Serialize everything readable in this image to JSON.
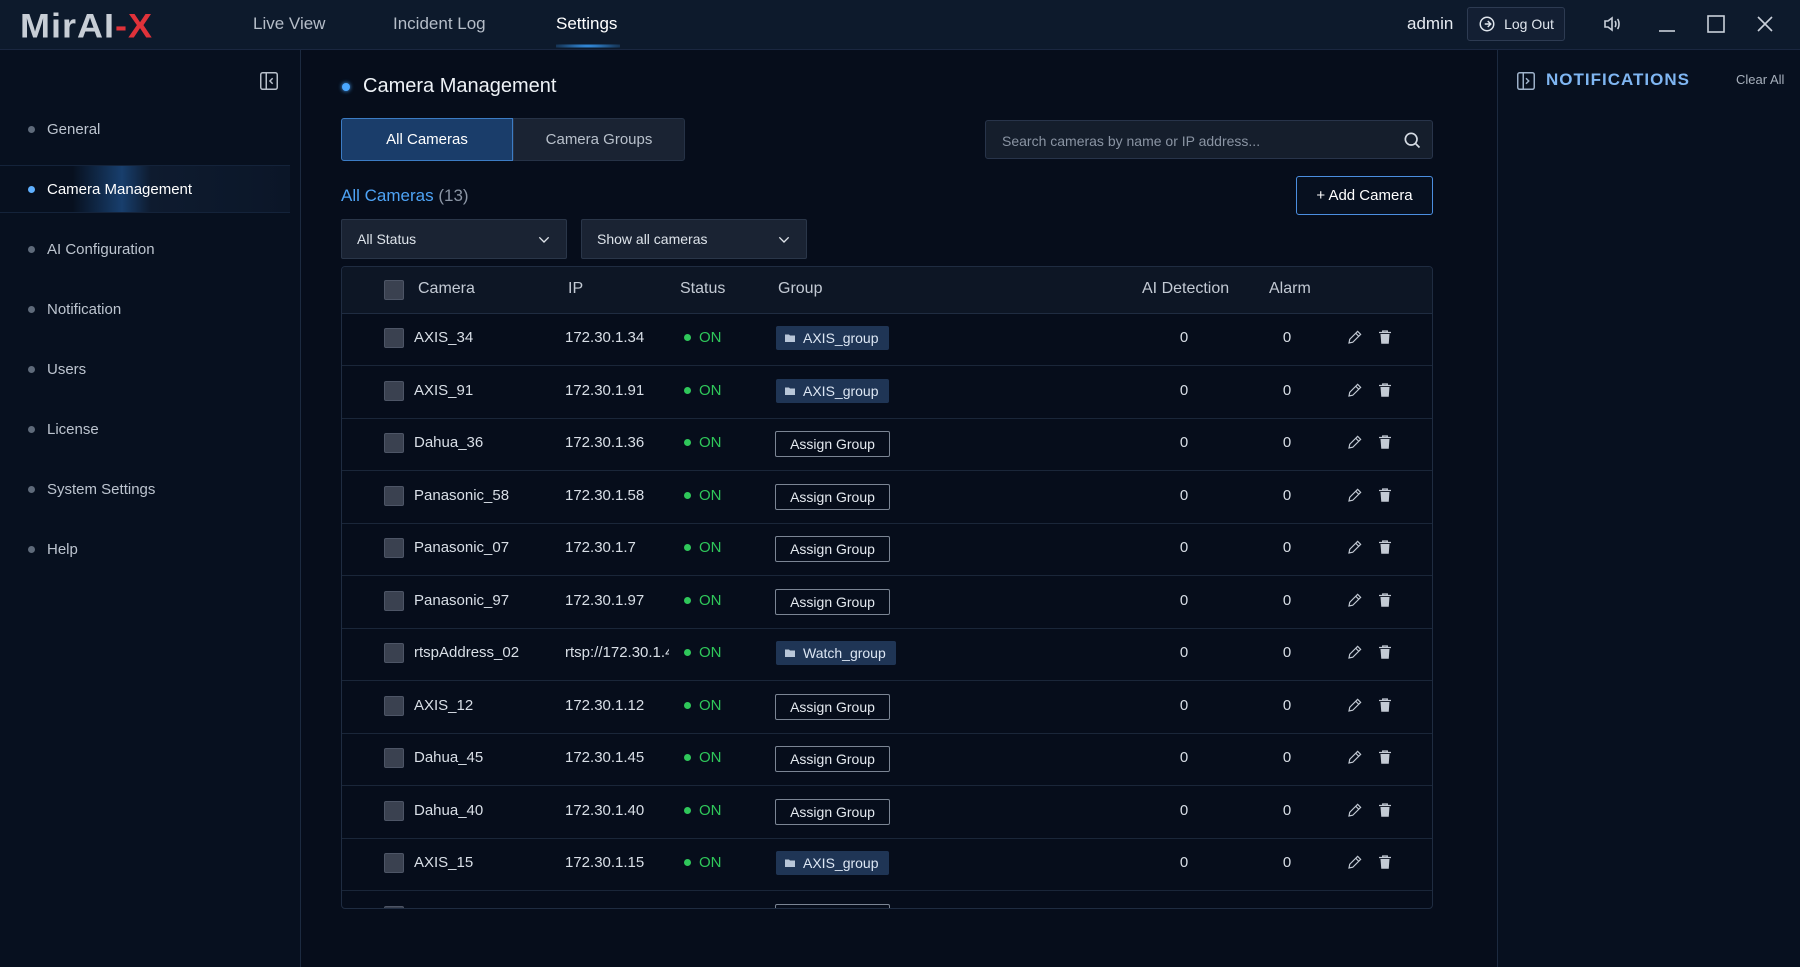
{
  "app": {
    "logo": "MirAI-X",
    "nav": [
      "Live View",
      "Incident Log",
      "Settings"
    ],
    "user": "admin",
    "logout_label": "Log Out"
  },
  "sidebar": {
    "items": [
      {
        "label": "General"
      },
      {
        "label": "Camera Management"
      },
      {
        "label": "AI Configuration"
      },
      {
        "label": "Notification"
      },
      {
        "label": "Users"
      },
      {
        "label": "License"
      },
      {
        "label": "System Settings"
      },
      {
        "label": "Help"
      }
    ],
    "active": "Camera Management"
  },
  "main": {
    "title": "Camera Management",
    "tabs": [
      "All Cameras",
      "Camera Groups"
    ],
    "active_tab": "All Cameras",
    "search_placeholder": "Search cameras by name or IP address...",
    "list_label": "All Cameras",
    "list_count": "(13)",
    "add_button": "+ Add Camera",
    "filters": {
      "status": "All Status",
      "visibility": "Show all cameras"
    }
  },
  "table": {
    "headers": [
      "Camera",
      "IP",
      "Status",
      "Group",
      "AI Detection",
      "Alarm"
    ],
    "assign_label": "Assign Group",
    "rows": [
      {
        "camera": "AXIS_34",
        "ip": "172.30.1.34",
        "status": "ON",
        "group": "AXIS_group",
        "ai": "0",
        "alarm": "0"
      },
      {
        "camera": "AXIS_91",
        "ip": "172.30.1.91",
        "status": "ON",
        "group": "AXIS_group",
        "ai": "0",
        "alarm": "0"
      },
      {
        "camera": "Dahua_36",
        "ip": "172.30.1.36",
        "status": "ON",
        "group": "",
        "ai": "0",
        "alarm": "0"
      },
      {
        "camera": "Panasonic_58",
        "ip": "172.30.1.58",
        "status": "ON",
        "group": "",
        "ai": "0",
        "alarm": "0"
      },
      {
        "camera": "Panasonic_07",
        "ip": "172.30.1.7",
        "status": "ON",
        "group": "",
        "ai": "0",
        "alarm": "0"
      },
      {
        "camera": "Panasonic_97",
        "ip": "172.30.1.97",
        "status": "ON",
        "group": "",
        "ai": "0",
        "alarm": "0"
      },
      {
        "camera": "rtspAddress_02",
        "ip": "rtsp://172.30.1.4",
        "status": "ON",
        "group": "Watch_group",
        "ai": "0",
        "alarm": "0"
      },
      {
        "camera": "AXIS_12",
        "ip": "172.30.1.12",
        "status": "ON",
        "group": "",
        "ai": "0",
        "alarm": "0"
      },
      {
        "camera": "Dahua_45",
        "ip": "172.30.1.45",
        "status": "ON",
        "group": "",
        "ai": "0",
        "alarm": "0"
      },
      {
        "camera": "Dahua_40",
        "ip": "172.30.1.40",
        "status": "ON",
        "group": "",
        "ai": "0",
        "alarm": "0"
      },
      {
        "camera": "AXIS_15",
        "ip": "172.30.1.15",
        "status": "ON",
        "group": "AXIS_group",
        "ai": "0",
        "alarm": "0"
      }
    ]
  },
  "notifications": {
    "title": "NOTIFICATIONS",
    "clear_label": "Clear All"
  },
  "colors": {
    "accent": "#4ea3f5",
    "status_on": "#2fc75a",
    "logo_x": "#e0323a",
    "background": "#060d1b"
  },
  "icons": [
    "logout-icon",
    "speaker-icon",
    "minimize-icon",
    "maximize-icon",
    "close-icon",
    "sidebar-collapse-icon",
    "search-icon",
    "chevron-down-icon",
    "folder-icon",
    "edit-icon",
    "trash-icon",
    "notifications-panel-icon"
  ]
}
